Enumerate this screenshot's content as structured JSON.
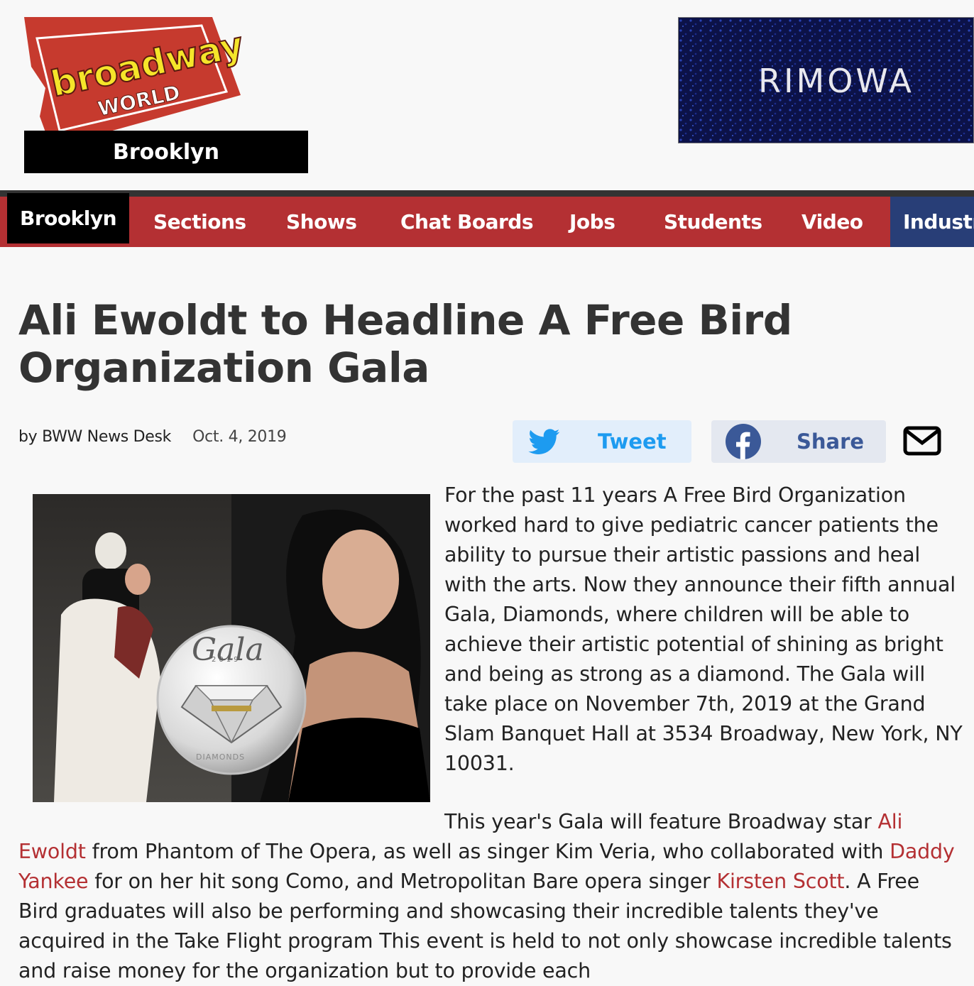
{
  "header": {
    "logo": {
      "line1": "broadway",
      "line2": "WORLD"
    },
    "location": "Brooklyn",
    "ad": {
      "brand": "RIMOWA"
    }
  },
  "nav": {
    "items": [
      {
        "label": "Brooklyn",
        "active": true
      },
      {
        "label": "Sections"
      },
      {
        "label": "Shows"
      },
      {
        "label": "Chat Boards"
      },
      {
        "label": "Jobs"
      },
      {
        "label": "Students"
      },
      {
        "label": "Video"
      },
      {
        "label": "Industr"
      }
    ]
  },
  "article": {
    "headline": "Ali Ewoldt to Headline A Free Bird Organization Gala",
    "byline": "by BWW News Desk",
    "date": "Oct. 4, 2019",
    "share": {
      "tweet_label": "Tweet",
      "share_label": "Share"
    },
    "photo": {
      "caption_text": "Gala",
      "year": "2019",
      "badge": "DIAMONDS"
    },
    "p1": "For the past 11 years A Free Bird Organization worked hard to give pediatric cancer patients the ability to pursue their artistic passions and heal with the arts. Now they announce their fifth annual Gala, Diamonds, where children will be able to achieve their artistic potential of shining as bright and being as strong as a diamond. The Gala will take place on November 7th, 2019 at the Grand Slam Banquet Hall at 3534 Broadway, New York, NY 10031.",
    "p2": {
      "t1": "This year's Gala will feature Broadway star ",
      "link1": "Ali Ewoldt",
      "t2": " from Phantom of The Opera, as well as singer Kim Veria, who collaborated with ",
      "link2": "Daddy Yankee",
      "t3": " for on her hit song Como, and Metropolitan Bare opera singer ",
      "link3": "Kirsten Scott",
      "t4": ". A Free Bird graduates will also be performing and showcasing their incredible talents they've acquired in the Take Flight program This event is held to not only showcase incredible talents and raise money for the organization but to provide each"
    }
  },
  "colors": {
    "brand_red": "#b43033",
    "nav_active": "#000000",
    "nav_industry": "#283e77",
    "twitter": "#1d9bf0",
    "facebook": "#3b5998"
  },
  "icons": [
    "twitter-icon",
    "facebook-icon",
    "mail-icon"
  ]
}
